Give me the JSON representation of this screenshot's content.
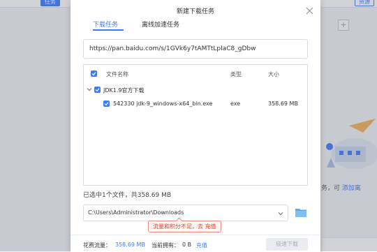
{
  "background": {
    "left_tag": "任务",
    "right_tag": "资源",
    "plus": "+",
    "hint_text": "务，可",
    "hint_link": "添加离"
  },
  "dialog": {
    "title": "新建下载任务",
    "tabs": [
      {
        "label": "下载任务",
        "active": true
      },
      {
        "label": "离线加速任务",
        "active": false
      }
    ],
    "url": "https://pan.baidu.com/s/1GVk6y7tAMTtLpIaC8_gDbw",
    "table": {
      "columns": {
        "name": "文件名称",
        "type": "类型",
        "size": "大小"
      },
      "group": {
        "name": "JDK1.9官方下载",
        "checked": true,
        "expanded": true
      },
      "files": [
        {
          "name": "542330 jdk-9_windows-x64_bin.exe",
          "type": "exe",
          "size": "358.69 MB",
          "checked": true
        }
      ]
    },
    "summary": "已选中1个文件，共358.69 MB",
    "save_path": "C:\\Users\\Administrator\\Downloads",
    "tooltip": "流量和积分不足，去 充值",
    "footer": {
      "flow_label": "花费流量：",
      "flow_value": "358.69 MB",
      "owned_label": "当前拥有：",
      "owned_value": "0 B",
      "recharge": "充值",
      "download_button": "极速下载"
    }
  },
  "colors": {
    "accent": "#3b7cff",
    "warning": "#e0432b",
    "folder": "#5aaee8"
  }
}
